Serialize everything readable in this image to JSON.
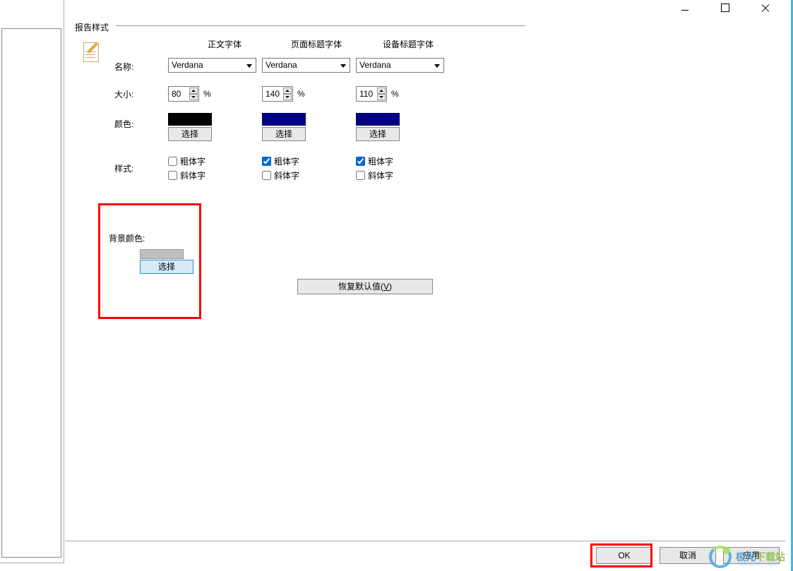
{
  "titlebar": {
    "min": "minimize",
    "max": "maximize",
    "close": "close"
  },
  "group": {
    "title": "报告样式",
    "headers": {
      "body_font": "正文字体",
      "page_title_font": "页面标题字体",
      "device_title_font": "设备标题字体"
    },
    "labels": {
      "name": "名称:",
      "size": "大小:",
      "color": "颜色:",
      "style": "样式:"
    },
    "fonts": {
      "body": "Verdana",
      "page": "Verdana",
      "device": "Verdana"
    },
    "sizes": {
      "body": "80",
      "page": "140",
      "device": "110",
      "percent": "%"
    },
    "choose_label": "选择",
    "colors": {
      "body": "#000000",
      "page": "#000080",
      "device": "#000080"
    },
    "checks": {
      "bold": "粗体字",
      "italic": "斜体字",
      "body_bold": false,
      "body_italic": false,
      "page_bold": true,
      "page_italic": false,
      "device_bold": true,
      "device_italic": false
    }
  },
  "background": {
    "title": "背景颜色:",
    "choose": "选择"
  },
  "restore_defaults": {
    "text": "恢复默认值(",
    "key": "V",
    "suffix": ")"
  },
  "buttons": {
    "ok": "OK",
    "cancel": "取消",
    "apply": "应用"
  },
  "watermark": {
    "line1a": "极光",
    "line1b": "下载站",
    "sub": "www.xz7.com"
  }
}
